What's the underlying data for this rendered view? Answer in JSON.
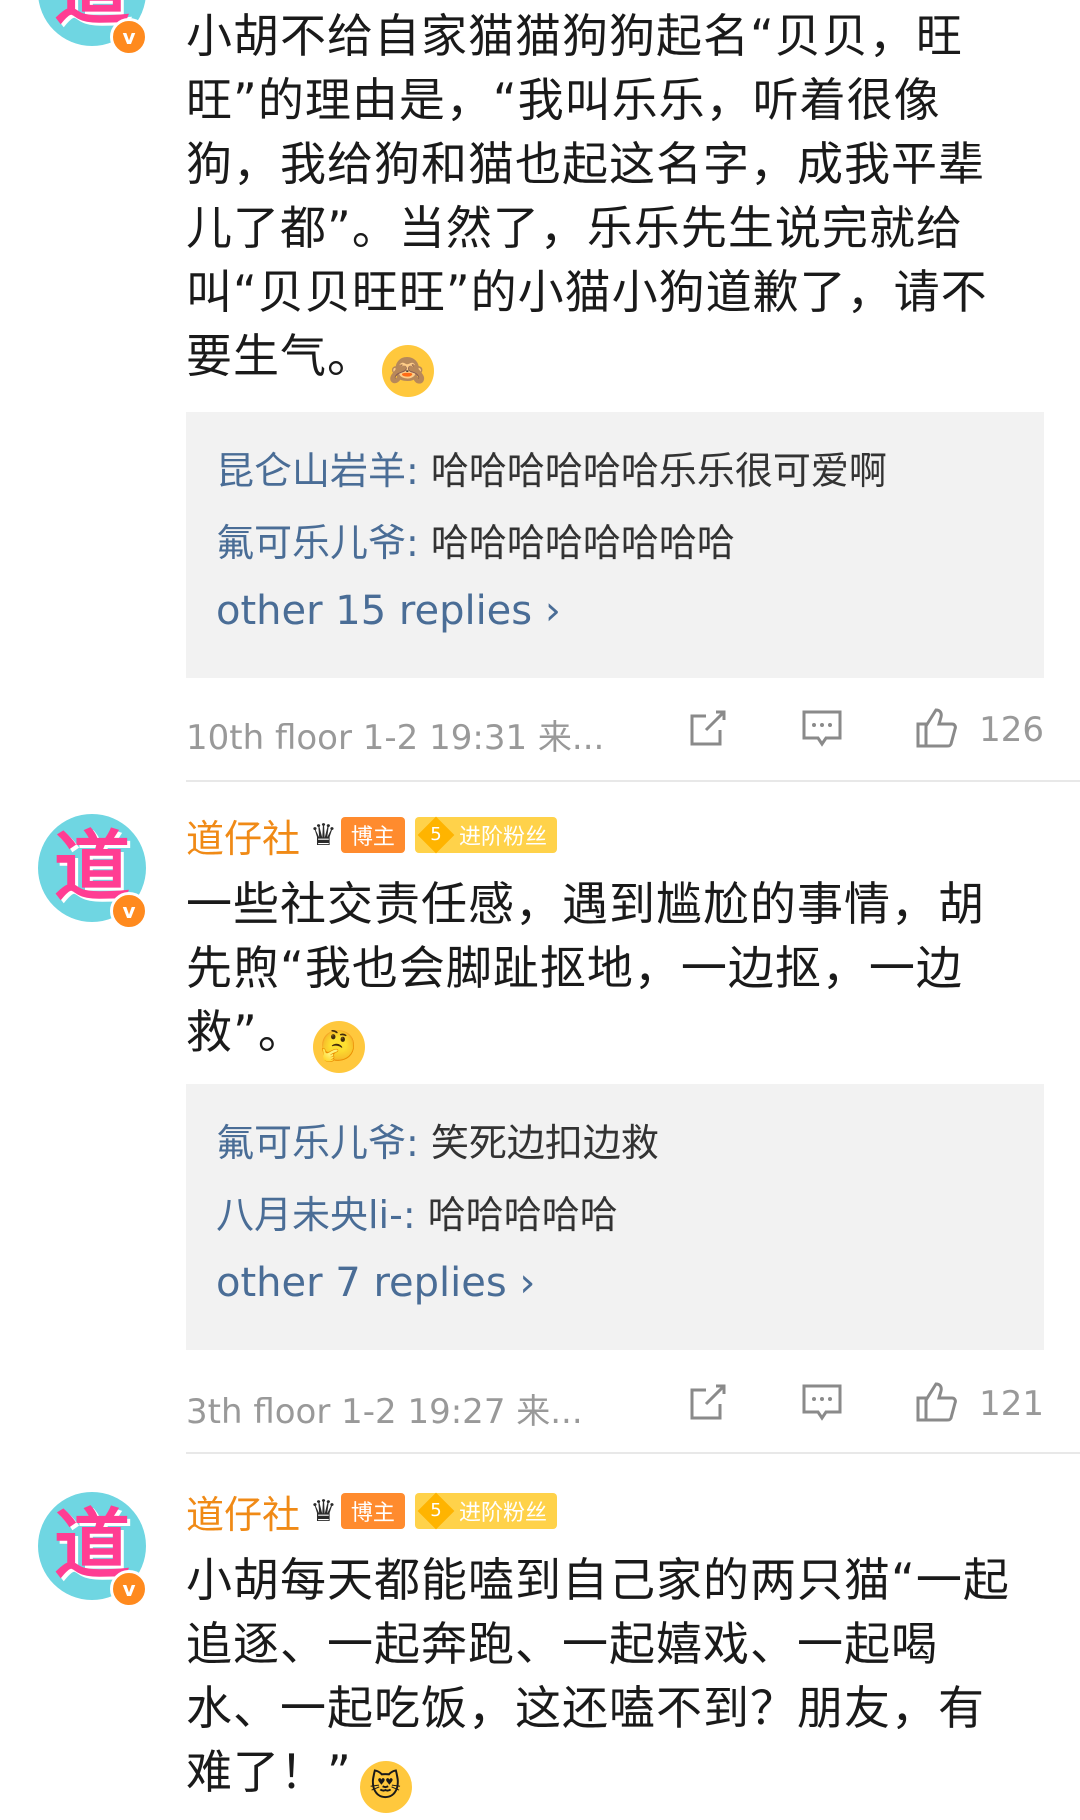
{
  "comments": [
    {
      "text": "小胡不给自家猫猫狗狗起名“贝贝，旺旺”的理由是，“我叫乐乐，听着很像狗，我给狗和猫也起这名字，成我平辈儿了都”。当然了，乐乐先生说完就给叫“贝贝旺旺”的小猫小狗道歉了，请不要生气。",
      "emoji": "see-no-evil-icon",
      "replies": [
        {
          "name": "昆仑山岩羊",
          "sep": ":",
          "text": " 哈哈哈哈哈哈乐乐很可爱啊"
        },
        {
          "name": "氟可乐儿爷",
          "sep": ":",
          "text": " 哈哈哈哈哈哈哈哈"
        }
      ],
      "more_replies": "other 15 replies",
      "meta": "10th floor 1-2 19:31 来...",
      "likes": "126"
    },
    {
      "username": "道仔社",
      "host_badge": "博主",
      "fan_level": "5",
      "fan_badge": "进阶粉丝",
      "text": "一些社交责任感，遇到尴尬的事情，胡先煦“我也会脚趾抠地，一边抠，一边救”。",
      "emoji": "thinking-face-icon",
      "replies": [
        {
          "name": "氟可乐儿爷",
          "sep": ":",
          "text": " 笑死边扣边救"
        },
        {
          "name": "八月未央li-",
          "sep": ":",
          "text": " 哈哈哈哈哈"
        }
      ],
      "more_replies": "other 7 replies",
      "meta": "3th floor 1-2 19:27 来...",
      "likes": "121"
    },
    {
      "username": "道仔社",
      "host_badge": "博主",
      "fan_level": "5",
      "fan_badge": "进阶粉丝",
      "text": "小胡每天都能嗑到自己家的两只猫“一起追逐、一起奔跑、一起嬉戏、一起喝水、一起吃饭，这还嗑不到？朋友，有难了！”",
      "emoji": "heart-eyes-cat-icon"
    }
  ],
  "avatar_glyph": "道",
  "verified_mark": "v"
}
